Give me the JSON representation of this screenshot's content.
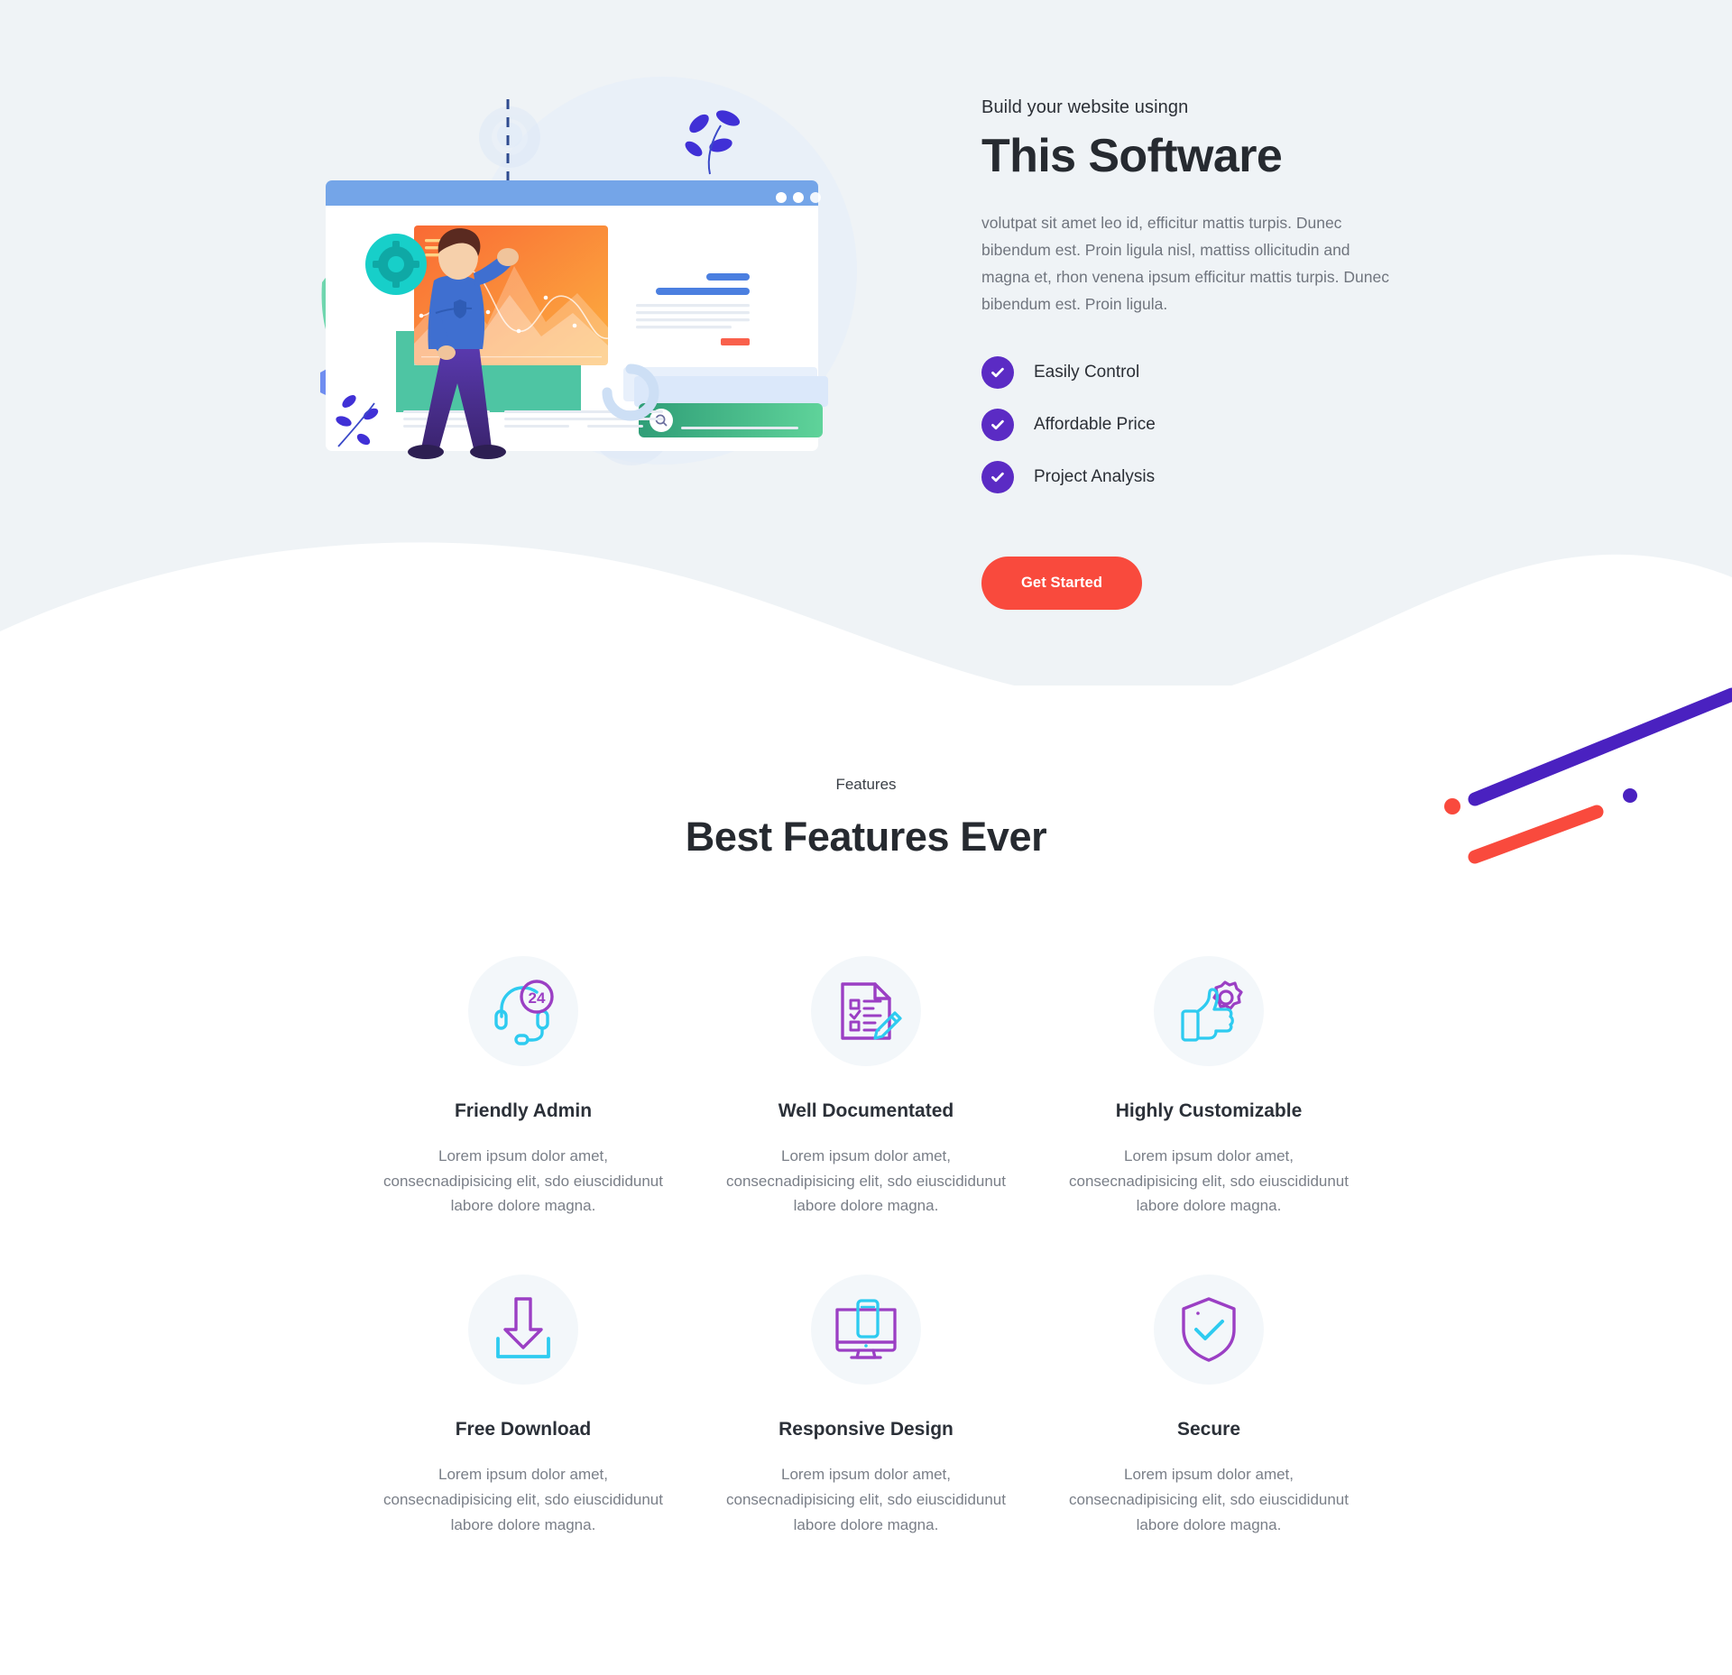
{
  "colors": {
    "hero_bg": "#eff3f6",
    "page_bg": "#ffffff",
    "accent_purple": "#5b2bc4",
    "accent_red": "#f94a3d",
    "icon_cyan": "#2ecbf0",
    "icon_purple": "#9b3fc4",
    "icon_circle_bg": "#f3f7fa",
    "heading": "#262a30",
    "body_text": "#70757e"
  },
  "hero": {
    "eyebrow": "Build your website usingn",
    "title": "This Software",
    "description": "volutpat sit amet leo id, efficitur mattis turpis. Dunec bibendum est. Proin ligula nisl, mattiss ollicitudin and magna et, rhon venena ipsum efficitur mattis turpis. Dunec bibendum est. Proin ligula.",
    "checklist": [
      {
        "label": "Easily Control",
        "icon": "check-icon"
      },
      {
        "label": "Affordable Price",
        "icon": "check-icon"
      },
      {
        "label": "Project Analysis",
        "icon": "check-icon"
      }
    ],
    "cta_label": "Get Started",
    "illustration": {
      "icon": "website-builder-illustration",
      "alt": "Person presenting analytics chart on a browser window"
    }
  },
  "features": {
    "eyebrow": "Features",
    "title": "Best Features Ever",
    "cards": [
      {
        "icon": "headset-24-support-icon",
        "name": "Friendly Admin",
        "description": "Lorem ipsum dolor amet, consecnadipisicing elit, sdo eiuscididunut labore dolore magna."
      },
      {
        "icon": "document-checklist-pencil-icon",
        "name": "Well Documentated",
        "description": "Lorem ipsum dolor amet, consecnadipisicing elit, sdo eiuscididunut labore dolore magna."
      },
      {
        "icon": "thumbs-up-gear-icon",
        "name": "Highly Customizable",
        "description": "Lorem ipsum dolor amet, consecnadipisicing elit, sdo eiuscididunut labore dolore magna."
      },
      {
        "icon": "download-arrow-icon",
        "name": "Free Download",
        "description": "Lorem ipsum dolor amet, consecnadipisicing elit, sdo eiuscididunut labore dolore magna."
      },
      {
        "icon": "monitor-phone-icon",
        "name": "Responsive Design",
        "description": "Lorem ipsum dolor amet, consecnadipisicing elit, sdo eiuscididunut labore dolore magna."
      },
      {
        "icon": "shield-check-icon",
        "name": "Secure",
        "description": "Lorem ipsum dolor amet, consecnadipisicing elit, sdo eiuscididunut labore dolore magna."
      }
    ]
  },
  "decoration": {
    "purple_line": "diagonal-purple-line",
    "red_line": "diagonal-red-line",
    "red_dot": "red-dot",
    "purple_dot": "purple-dot"
  }
}
